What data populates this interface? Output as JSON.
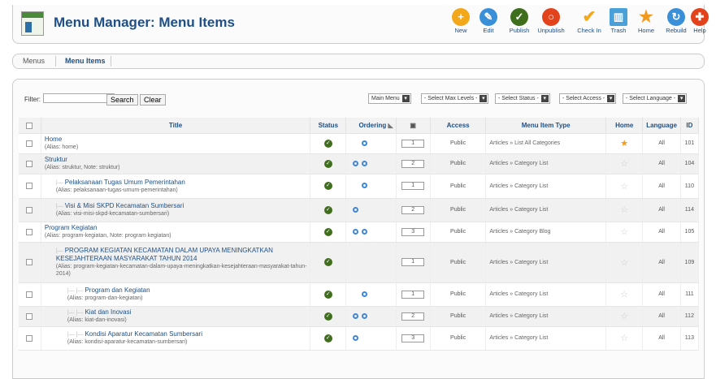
{
  "header": {
    "title": "Menu Manager: Menu Items"
  },
  "toolbar": {
    "new": "New",
    "edit": "Edit",
    "publish": "Publish",
    "unpublish": "Unpublish",
    "checkin": "Check In",
    "trash": "Trash",
    "home": "Home",
    "rebuild": "Rebuild",
    "help": "Help"
  },
  "submenu": {
    "menus": "Menus",
    "menu_items": "Menu Items"
  },
  "filter": {
    "label": "Filter:",
    "search": "Search",
    "clear": "Clear",
    "menu": "Main Menu",
    "levels": "- Select Max Levels -",
    "status": "- Select Status -",
    "access": "- Select Access -",
    "language": "- Select Language -"
  },
  "columns": {
    "title": "Title",
    "status": "Status",
    "ordering": "Ordering",
    "access": "Access",
    "type": "Menu Item Type",
    "home": "Home",
    "language": "Language",
    "id": "ID"
  },
  "rows": [
    {
      "prefix": "",
      "title": "Home",
      "alias": "(Alias: home)",
      "up": false,
      "down": true,
      "order": "1",
      "access": "Public",
      "type": "Articles » List All Categories",
      "home": true,
      "language": "All",
      "id": "101"
    },
    {
      "prefix": "",
      "title": "Struktur",
      "alias": "(Alias: struktur, Note: struktur)",
      "up": true,
      "down": true,
      "order": "2",
      "access": "Public",
      "type": "Articles » Category List",
      "home": false,
      "language": "All",
      "id": "104"
    },
    {
      "prefix": "|—",
      "title": "Pelaksanaan Tugas Umum Pemerintahan",
      "alias": "(Alias: pelaksanaan-tugas-umum-pemerintahan)",
      "up": false,
      "down": true,
      "order": "1",
      "access": "Public",
      "type": "Articles » Category List",
      "home": false,
      "language": "All",
      "id": "110"
    },
    {
      "prefix": "|—",
      "title": "Visi & Misi SKPD Kecamatan Sumbersari",
      "alias": "(Alias: visi-misi-skpd-kecamatan-sumbersari)",
      "up": true,
      "down": false,
      "order": "2",
      "access": "Public",
      "type": "Articles » Category List",
      "home": false,
      "language": "All",
      "id": "114"
    },
    {
      "prefix": "",
      "title": "Program Kegiatan",
      "alias": "(Alias: program-kegiatan, Note: program kegiatan)",
      "up": true,
      "down": true,
      "order": "3",
      "access": "Public",
      "type": "Articles » Category Blog",
      "home": false,
      "language": "All",
      "id": "105"
    },
    {
      "prefix": "|—",
      "title": "PROGRAM KEGIATAN KECAMATAN DALAM UPAYA MENINGKATKAN KESEJAHTERAAN MASYARAKAT TAHUN 2014",
      "alias": "(Alias: program-kegiatan-kecamatan-dalam-upaya-meningkatkan-kesejahteraan-masyarakat-tahun-2014)",
      "up": false,
      "down": false,
      "order": "1",
      "access": "Public",
      "type": "Articles » Category List",
      "home": false,
      "language": "All",
      "id": "109"
    },
    {
      "prefix": "|— |—",
      "title": "Program dan Kegiatan",
      "alias": "(Alias: program-dan-kegiatan)",
      "up": false,
      "down": true,
      "order": "1",
      "access": "Public",
      "type": "Articles » Category List",
      "home": false,
      "language": "All",
      "id": "111"
    },
    {
      "prefix": "|— |—",
      "title": "Kiat dan Inovasi",
      "alias": "(Alias: kiat-dan-inovasi)",
      "up": true,
      "down": true,
      "order": "2",
      "access": "Public",
      "type": "Articles » Category List",
      "home": false,
      "language": "All",
      "id": "112"
    },
    {
      "prefix": "|— |—",
      "title": "Kondisi Aparatur Kecamatan Sumbersari",
      "alias": "(Alias: kondisi-aparatur-kecamatan-sumbersari)",
      "up": true,
      "down": false,
      "order": "3",
      "access": "Public",
      "type": "Articles » Category List",
      "home": false,
      "language": "All",
      "id": "113"
    }
  ],
  "colors": {
    "link": "#1e4f86",
    "publish": "#3f6e1d",
    "home_star": "#f29a1d"
  }
}
